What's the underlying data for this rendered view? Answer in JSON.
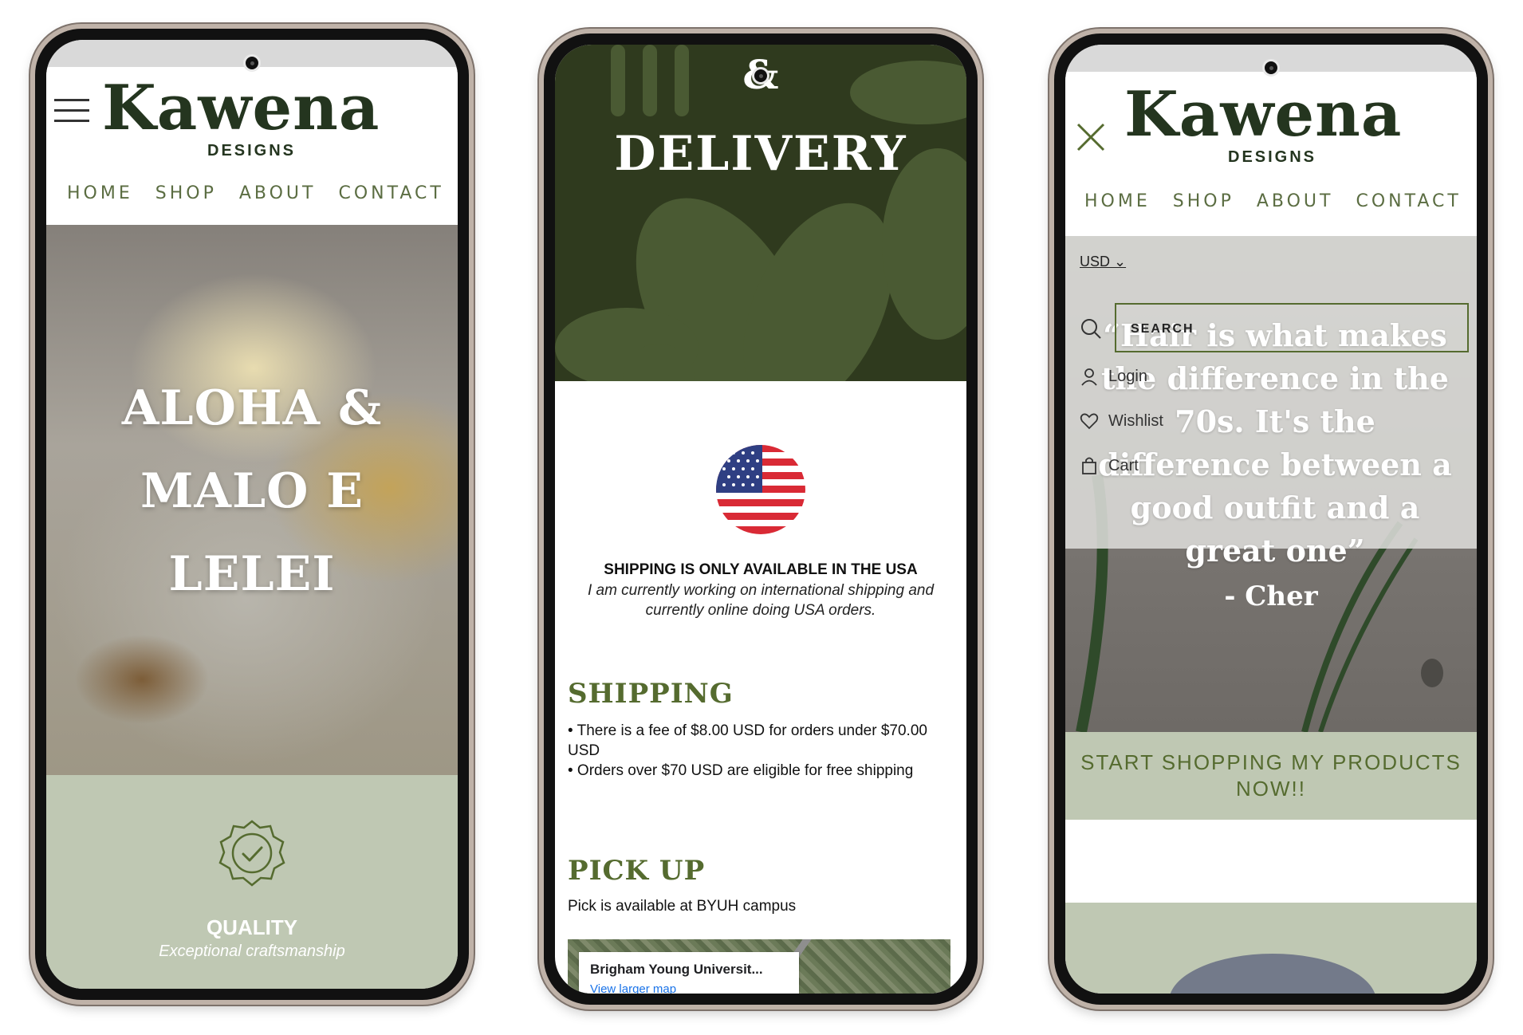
{
  "brand": {
    "logo_word": "Kawena",
    "logo_sub": "DESIGNS"
  },
  "nav": [
    "HOME",
    "SHOP",
    "ABOUT",
    "CONTACT"
  ],
  "phone1": {
    "hero_lines": [
      "ALOHA &",
      "MALO E",
      "LELEI"
    ],
    "feature": {
      "title": "QUALITY",
      "subtitle": "Exceptional craftsmanship",
      "icon": "badge-check-icon"
    }
  },
  "phone2": {
    "banner_symbol": "&",
    "banner_title": "DELIVERY",
    "notice_bold": "SHIPPING IS ONLY AVAILABLE IN THE USA",
    "notice_italic": "I am currently working on international shipping and currently online doing USA orders.",
    "shipping_heading": "SHIPPING",
    "shipping_items": [
      "• There is a fee of $8.00 USD for orders under $70.00 USD",
      "• Orders over $70 USD are eligible for free shipping"
    ],
    "pickup_heading": "PICK UP",
    "pickup_text": "Pick is available at BYUH campus",
    "map": {
      "place": "Brigham Young Universit...",
      "link": "View larger map"
    }
  },
  "phone3": {
    "currency": "USD ⌄",
    "search_placeholder": "SEARCH",
    "menu": [
      {
        "label": "Login",
        "icon": "user-icon"
      },
      {
        "label": "Wishlist",
        "icon": "heart-icon"
      },
      {
        "label": "Cart",
        "icon": "shopping-bag-icon"
      }
    ],
    "quote": "“Hair is what makes the difference in the 70s. It's the difference between a good outfit and a great one”",
    "author": "- Cher",
    "cta": "START SHOPPING MY PRODUCTS NOW!!"
  },
  "colors": {
    "brand_dark": "#24351f",
    "olive": "#556b2f",
    "sage": "#bfc8b3",
    "delivery_banner": "#2f3a1e"
  }
}
